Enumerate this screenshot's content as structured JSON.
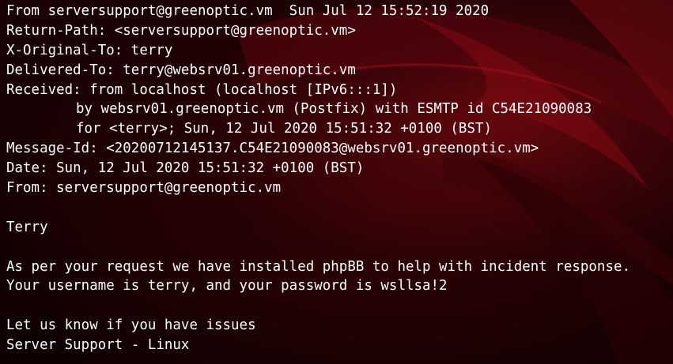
{
  "terminal": {
    "lines": {
      "from_line": "From serversupport@greenoptic.vm  Sun Jul 12 15:52:19 2020",
      "return_path": "Return-Path: <serversupport@greenoptic.vm>",
      "x_original_to": "X-Original-To: terry",
      "delivered_to": "Delivered-To: terry@websrv01.greenoptic.vm",
      "received_1": "Received: from localhost (localhost [IPv6:::1])",
      "received_2": "by websrv01.greenoptic.vm (Postfix) with ESMTP id C54E21090083",
      "received_3": "for <terry>; Sun, 12 Jul 2020 15:51:32 +0100 (BST)",
      "message_id": "Message-Id: <20200712145137.C54E21090083@websrv01.greenoptic.vm>",
      "date": "Date: Sun, 12 Jul 2020 15:51:32 +0100 (BST)",
      "from_header": "From: serversupport@greenoptic.vm",
      "greeting": "Terry",
      "body_1": "As per your request we have installed phpBB to help with incident response.",
      "body_2": "Your username is terry, and your password is wsllsa!2",
      "closing": "Let us know if you have issues",
      "signature": "Server Support - Linux"
    }
  },
  "colors": {
    "text": "#ffffff",
    "background": "#140103",
    "accent_red": "#b0101c"
  }
}
